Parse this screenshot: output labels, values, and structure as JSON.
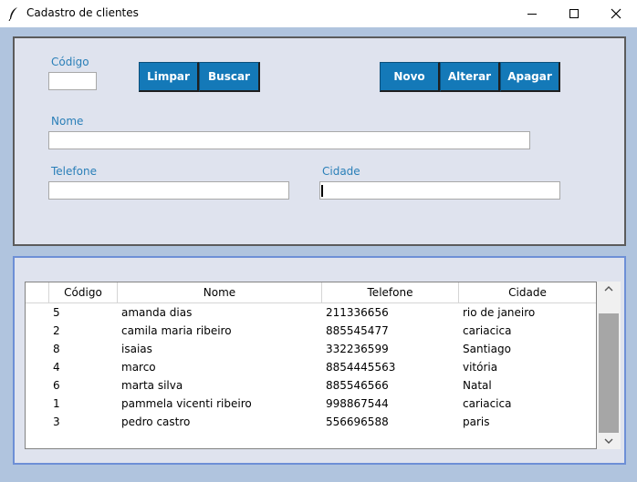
{
  "window": {
    "title": "Cadastro de clientes",
    "minimize_icon": "minimize-icon",
    "maximize_icon": "maximize-icon",
    "close_icon": "close-icon"
  },
  "form": {
    "codigo_label": "Código",
    "codigo_value": "",
    "nome_label": "Nome",
    "nome_value": "",
    "telefone_label": "Telefone",
    "telefone_value": "",
    "cidade_label": "Cidade",
    "cidade_value": ""
  },
  "buttons": {
    "limpar": "Limpar",
    "buscar": "Buscar",
    "novo": "Novo",
    "alterar": "Alterar",
    "apagar": "Apagar"
  },
  "table": {
    "columns": [
      "Código",
      "Nome",
      "Telefone",
      "Cidade"
    ],
    "rows": [
      [
        "5",
        "amanda dias",
        "211336656",
        "rio de janeiro"
      ],
      [
        "2",
        "camila maria ribeiro",
        "885545477",
        "cariacica"
      ],
      [
        "8",
        "isaias",
        "332236599",
        "Santiago"
      ],
      [
        "4",
        "marco",
        "8854445563",
        "vitória"
      ],
      [
        "6",
        "marta silva",
        "885546566",
        "Natal"
      ],
      [
        "1",
        "pammela vicenti ribeiro",
        "998867544",
        "cariacica"
      ],
      [
        "3",
        "pedro castro",
        "556696588",
        "paris"
      ]
    ]
  },
  "colors": {
    "window_bg": "#b0c4de",
    "panel_bg": "#dfe3ee",
    "button_bg": "#1479b8",
    "label_color": "#2a7fb8"
  }
}
